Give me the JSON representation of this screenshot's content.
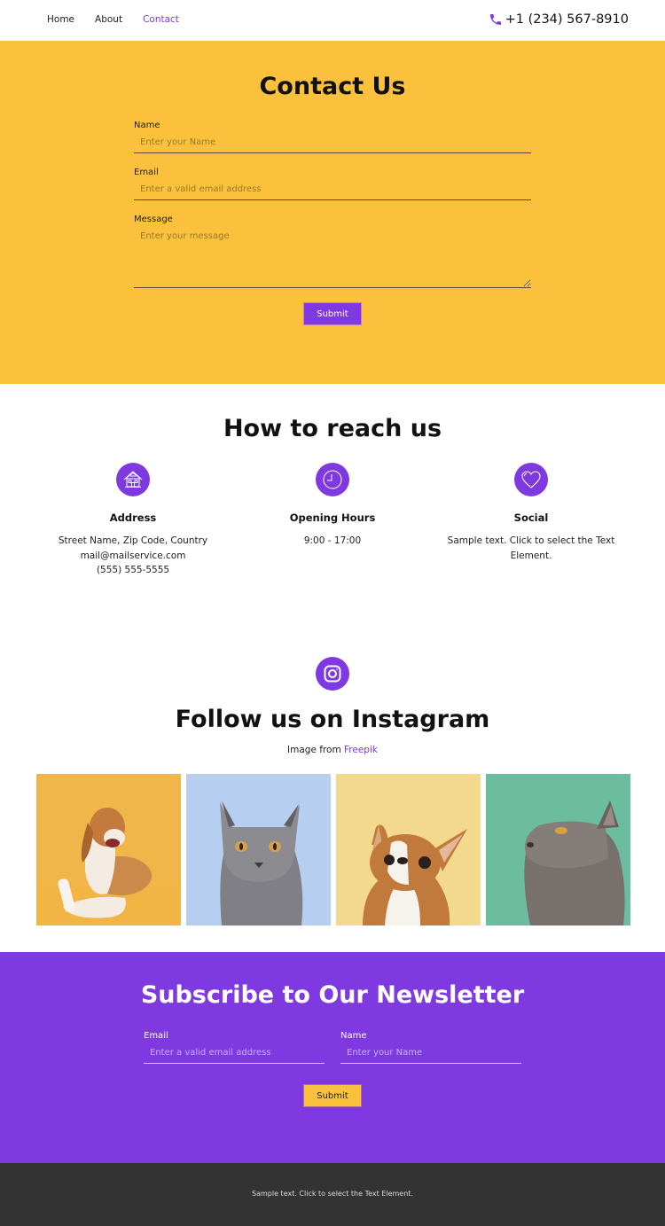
{
  "header": {
    "nav": [
      {
        "label": "Home",
        "active": false
      },
      {
        "label": "About",
        "active": false
      },
      {
        "label": "Contact",
        "active": true
      }
    ],
    "phone_icon": "phone-icon",
    "phone": "+1 (234) 567-8910"
  },
  "contact": {
    "title": "Contact Us",
    "fields": {
      "name": {
        "label": "Name",
        "placeholder": "Enter your Name",
        "value": ""
      },
      "email": {
        "label": "Email",
        "placeholder": "Enter a valid email address",
        "value": ""
      },
      "message": {
        "label": "Message",
        "placeholder": "Enter your message",
        "value": ""
      }
    },
    "submit_label": "Submit"
  },
  "reach": {
    "title": "How to reach us",
    "columns": [
      {
        "icon": "house-icon",
        "title": "Address",
        "lines": [
          "Street Name, Zip Code, Country",
          "mail@mailservice.com",
          "(555) 555-5555"
        ]
      },
      {
        "icon": "clock-icon",
        "title": "Opening Hours",
        "lines": [
          "9:00 - 17:00"
        ]
      },
      {
        "icon": "heart-icon",
        "title": "Social",
        "lines": [
          "Sample text. Click to select the Text Element."
        ]
      }
    ]
  },
  "instagram": {
    "icon": "instagram-icon",
    "title": "Follow us on Instagram",
    "credit_prefix": "Image from ",
    "credit_link": "Freepik",
    "photos": [
      {
        "subject": "beagle dog with bone on orange background",
        "bg": "#f0b64a"
      },
      {
        "subject": "grey british shorthair cat on light blue background",
        "bg": "#b6cff0"
      },
      {
        "subject": "chihuahua dog on pale yellow background",
        "bg": "#f3d98e"
      },
      {
        "subject": "grey cat looking up on teal background",
        "bg": "#6cbca0"
      }
    ]
  },
  "newsletter": {
    "title": "Subscribe to Our Newsletter",
    "fields": {
      "email": {
        "label": "Email",
        "placeholder": "Enter a valid email address",
        "value": ""
      },
      "name": {
        "label": "Name",
        "placeholder": "Enter your Name",
        "value": ""
      }
    },
    "submit_label": "Submit"
  },
  "footer": {
    "text": "Sample text. Click to select the Text Element."
  },
  "colors": {
    "accent_purple": "#7e3ae0",
    "accent_yellow": "#fbc13c",
    "footer_bg": "#333333"
  }
}
